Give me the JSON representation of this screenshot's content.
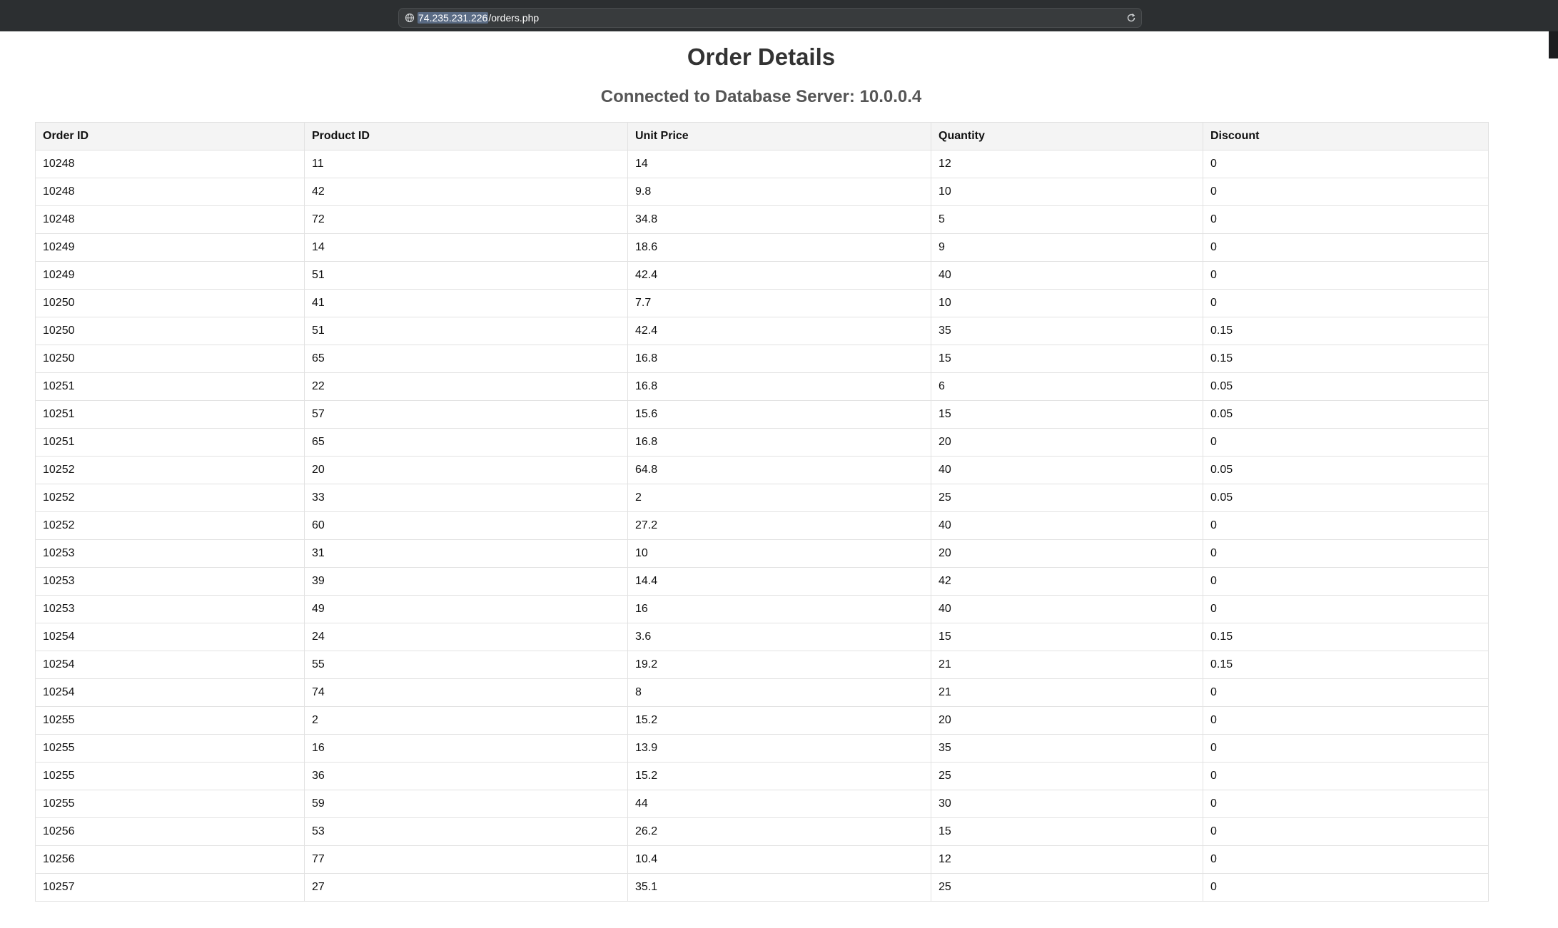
{
  "browser": {
    "url_host": "74.235.231.226",
    "url_path": "/orders.php",
    "globe_icon": "globe-icon",
    "reload_icon": "reload-icon"
  },
  "page": {
    "title": "Order Details",
    "subtitle": "Connected to Database Server: 10.0.0.4"
  },
  "table": {
    "headers": [
      "Order ID",
      "Product ID",
      "Unit Price",
      "Quantity",
      "Discount"
    ],
    "rows": [
      [
        "10248",
        "11",
        "14",
        "12",
        "0"
      ],
      [
        "10248",
        "42",
        "9.8",
        "10",
        "0"
      ],
      [
        "10248",
        "72",
        "34.8",
        "5",
        "0"
      ],
      [
        "10249",
        "14",
        "18.6",
        "9",
        "0"
      ],
      [
        "10249",
        "51",
        "42.4",
        "40",
        "0"
      ],
      [
        "10250",
        "41",
        "7.7",
        "10",
        "0"
      ],
      [
        "10250",
        "51",
        "42.4",
        "35",
        "0.15"
      ],
      [
        "10250",
        "65",
        "16.8",
        "15",
        "0.15"
      ],
      [
        "10251",
        "22",
        "16.8",
        "6",
        "0.05"
      ],
      [
        "10251",
        "57",
        "15.6",
        "15",
        "0.05"
      ],
      [
        "10251",
        "65",
        "16.8",
        "20",
        "0"
      ],
      [
        "10252",
        "20",
        "64.8",
        "40",
        "0.05"
      ],
      [
        "10252",
        "33",
        "2",
        "25",
        "0.05"
      ],
      [
        "10252",
        "60",
        "27.2",
        "40",
        "0"
      ],
      [
        "10253",
        "31",
        "10",
        "20",
        "0"
      ],
      [
        "10253",
        "39",
        "14.4",
        "42",
        "0"
      ],
      [
        "10253",
        "49",
        "16",
        "40",
        "0"
      ],
      [
        "10254",
        "24",
        "3.6",
        "15",
        "0.15"
      ],
      [
        "10254",
        "55",
        "19.2",
        "21",
        "0.15"
      ],
      [
        "10254",
        "74",
        "8",
        "21",
        "0"
      ],
      [
        "10255",
        "2",
        "15.2",
        "20",
        "0"
      ],
      [
        "10255",
        "16",
        "13.9",
        "35",
        "0"
      ],
      [
        "10255",
        "36",
        "15.2",
        "25",
        "0"
      ],
      [
        "10255",
        "59",
        "44",
        "30",
        "0"
      ],
      [
        "10256",
        "53",
        "26.2",
        "15",
        "0"
      ],
      [
        "10256",
        "77",
        "10.4",
        "12",
        "0"
      ],
      [
        "10257",
        "27",
        "35.1",
        "25",
        "0"
      ]
    ]
  },
  "colors": {
    "browser_bar": "#2c2f31",
    "header_bg": "#f4f4f4",
    "border": "#e2e2e2",
    "title": "#333333",
    "subtitle": "#555555"
  }
}
